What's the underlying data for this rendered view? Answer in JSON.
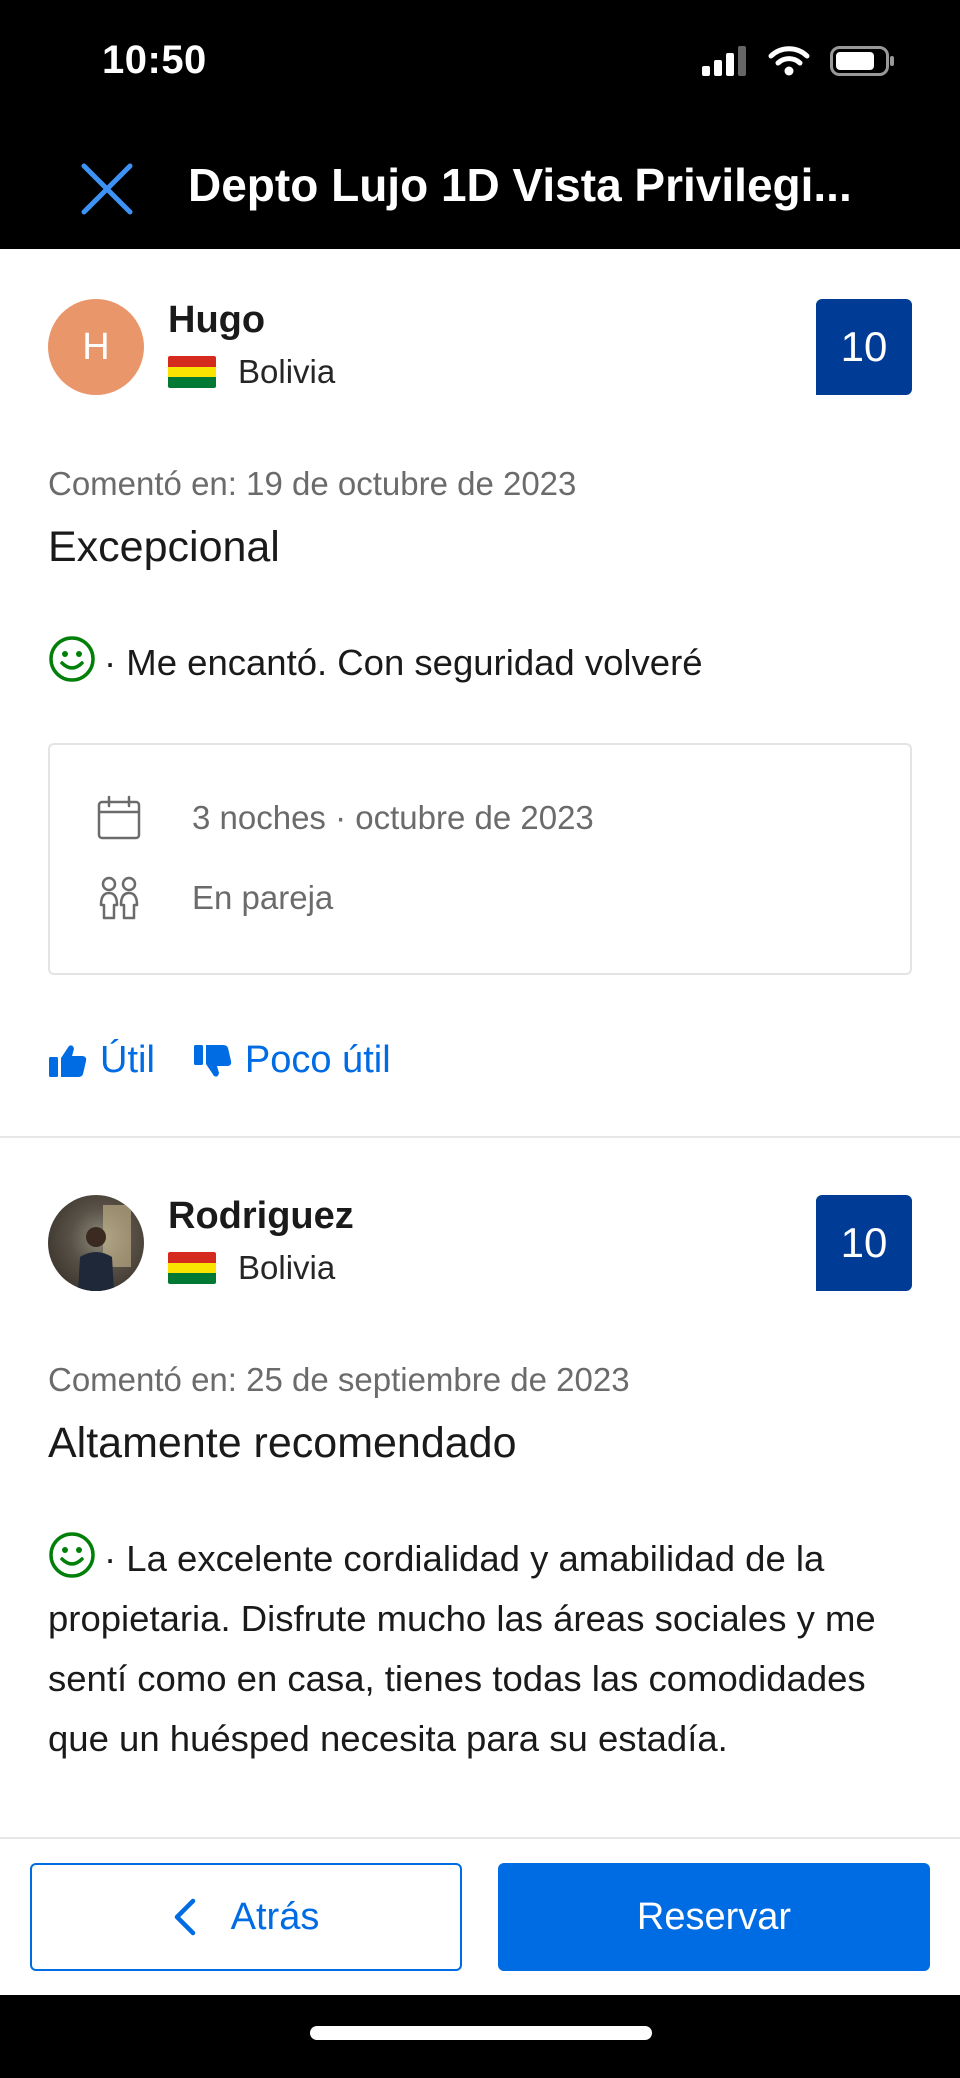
{
  "status_bar": {
    "time": "10:50"
  },
  "header": {
    "title": "Depto Lujo 1D Vista Privilegi..."
  },
  "flag_colors": [
    "#d52b1e",
    "#f9e300",
    "#007934"
  ],
  "colors": {
    "brand_dark": "#003b95",
    "link": "#006ce4",
    "positive": "#008009"
  },
  "reviews": [
    {
      "initial": "H",
      "name": "Hugo",
      "country": "Bolivia",
      "score": "10",
      "date": "Comentó en: 19 de octubre de 2023",
      "title": "Excepcional",
      "body": "· Me encantó. Con seguridad volveré",
      "stay": {
        "nights": "3 noches · octubre de 2023",
        "traveler": "En pareja"
      },
      "feedback": {
        "useful": "Útil",
        "not_useful": "Poco útil"
      }
    },
    {
      "name": "Rodriguez",
      "country": "Bolivia",
      "score": "10",
      "date": "Comentó en: 25 de septiembre de 2023",
      "title": "Altamente recomendado",
      "body": "· La excelente cordialidad y amabilidad de la propietaria. Disfrute mucho las áreas sociales y me sentí como en casa, tienes todas las comodidades que un huésped necesita para su estadía."
    }
  ],
  "bottom_bar": {
    "back_label": "Atrás",
    "reserve_label": "Reservar"
  }
}
